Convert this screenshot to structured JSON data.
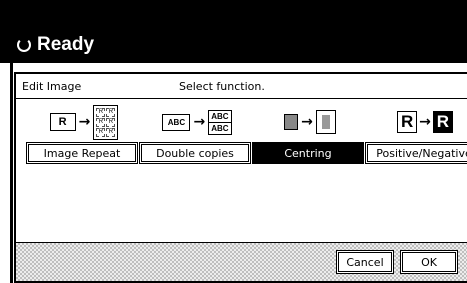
{
  "status": {
    "text": "Ready"
  },
  "panel": {
    "title": "Edit Image",
    "prompt": "Select function."
  },
  "functions": [
    {
      "label": "Image Repeat",
      "icon_text": "R",
      "tile_text": "R",
      "selected": false
    },
    {
      "label": "Double copies",
      "icon_text": "ABC",
      "selected": false
    },
    {
      "label": "Centring",
      "selected": true
    },
    {
      "label": "Positive/Negative",
      "icon_text": "R",
      "selected": false
    }
  ],
  "footer": {
    "cancel_label": "Cancel",
    "ok_label": "OK"
  }
}
